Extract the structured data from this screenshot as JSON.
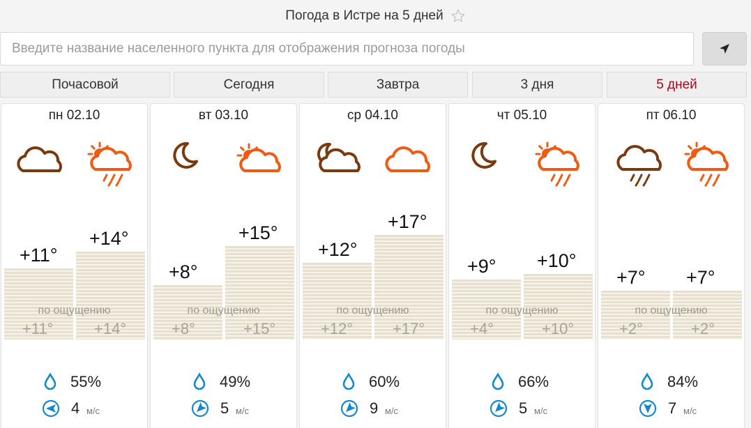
{
  "header": {
    "title": "Погода в Истре на 5 дней"
  },
  "search": {
    "placeholder": "Введите название населенного пункта для отображения прогноза погоды"
  },
  "tabs": [
    {
      "label": "Почасовой",
      "active": false
    },
    {
      "label": "Сегодня",
      "active": false
    },
    {
      "label": "Завтра",
      "active": false
    },
    {
      "label": "3 дня",
      "active": false
    },
    {
      "label": "5 дней",
      "active": true
    }
  ],
  "colors": {
    "active_tab": "#b0001a",
    "night_icon": "#7a3a10",
    "day_icon": "#f05a12",
    "water_icon": "#1488cc"
  },
  "feels_label": "по ощущению",
  "wind_unit": "м/с",
  "days": [
    {
      "date": "пн 02.10",
      "night_icon": "cloudy-icon",
      "day_icon": "sun-cloud-rain-icon",
      "night_temp": "+11°",
      "day_temp": "+14°",
      "night_feels": "+11°",
      "day_feels": "+14°",
      "humidity": "55%",
      "wind": "4",
      "wind_direction": "west"
    },
    {
      "date": "вт 03.10",
      "night_icon": "moon-icon",
      "day_icon": "sun-cloud-icon",
      "night_temp": "+8°",
      "day_temp": "+15°",
      "night_feels": "+8°",
      "day_feels": "+15°",
      "humidity": "49%",
      "wind": "5",
      "wind_direction": "south-west"
    },
    {
      "date": "ср 04.10",
      "night_icon": "moon-cloud-icon",
      "day_icon": "cloudy-icon",
      "night_temp": "+12°",
      "day_temp": "+17°",
      "night_feels": "+12°",
      "day_feels": "+17°",
      "humidity": "60%",
      "wind": "9",
      "wind_direction": "south-west"
    },
    {
      "date": "чт 05.10",
      "night_icon": "moon-icon",
      "day_icon": "sun-cloud-rain-icon",
      "night_temp": "+9°",
      "day_temp": "+10°",
      "night_feels": "+4°",
      "day_feels": "+10°",
      "humidity": "66%",
      "wind": "5",
      "wind_direction": "south-west"
    },
    {
      "date": "пт 06.10",
      "night_icon": "cloud-rain-icon",
      "day_icon": "sun-cloud-rain-icon",
      "night_temp": "+7°",
      "day_temp": "+7°",
      "night_feels": "+2°",
      "day_feels": "+2°",
      "humidity": "84%",
      "wind": "7",
      "wind_direction": "south"
    }
  ]
}
